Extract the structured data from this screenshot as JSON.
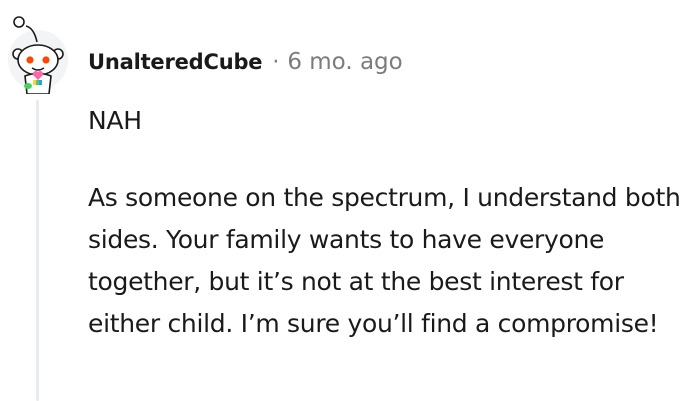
{
  "comment": {
    "author": "UnalteredCube",
    "separator": "·",
    "timestamp": "6 mo. ago",
    "avatar_icon": "reddit-snoo-avatar-icon",
    "body": {
      "paragraphs": [
        "NAH",
        "As someone on the spectrum, I understand both sides. Your family wants to have everyone together, but it’s not at the best interest for either child. I’m sure you’ll find a compromise!"
      ]
    }
  },
  "colors": {
    "text": "#1a1a1b",
    "meta": "#7c7c7c",
    "thread_line": "#e5ebee",
    "avatar_bg": "#f2f4f5",
    "snoo_accent": "#ff4500"
  }
}
